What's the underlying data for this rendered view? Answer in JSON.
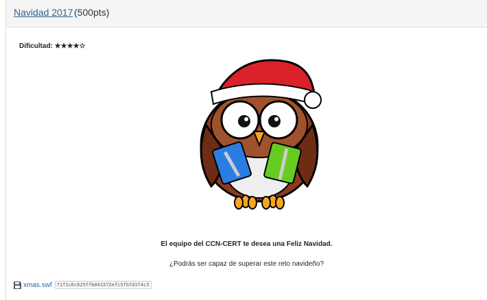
{
  "challenge": {
    "title": "Navidad 2017",
    "points": "(500pts)",
    "difficulty_label": "Dificultad:",
    "difficulty_stars": "★★★★☆"
  },
  "illustration": {
    "icon": "christmas-owl-illustration",
    "colors": {
      "hat": "#d9222a",
      "body": "#8b3a1e",
      "gift_blue": "#2a7de1",
      "gift_green": "#66cc22",
      "beak_feet": "#f5a623"
    }
  },
  "body": {
    "greeting": "El equipo del CCN-CERT te desea una Feliz Navidad.",
    "question": "¿Podrás ser capaz de superar este reto navideño?"
  },
  "attachment": {
    "icon": "save-floppy-icon",
    "filename": "xmas.swf",
    "hash": "71f1c6c625ffb041572efc5fb7d1f4c5"
  }
}
